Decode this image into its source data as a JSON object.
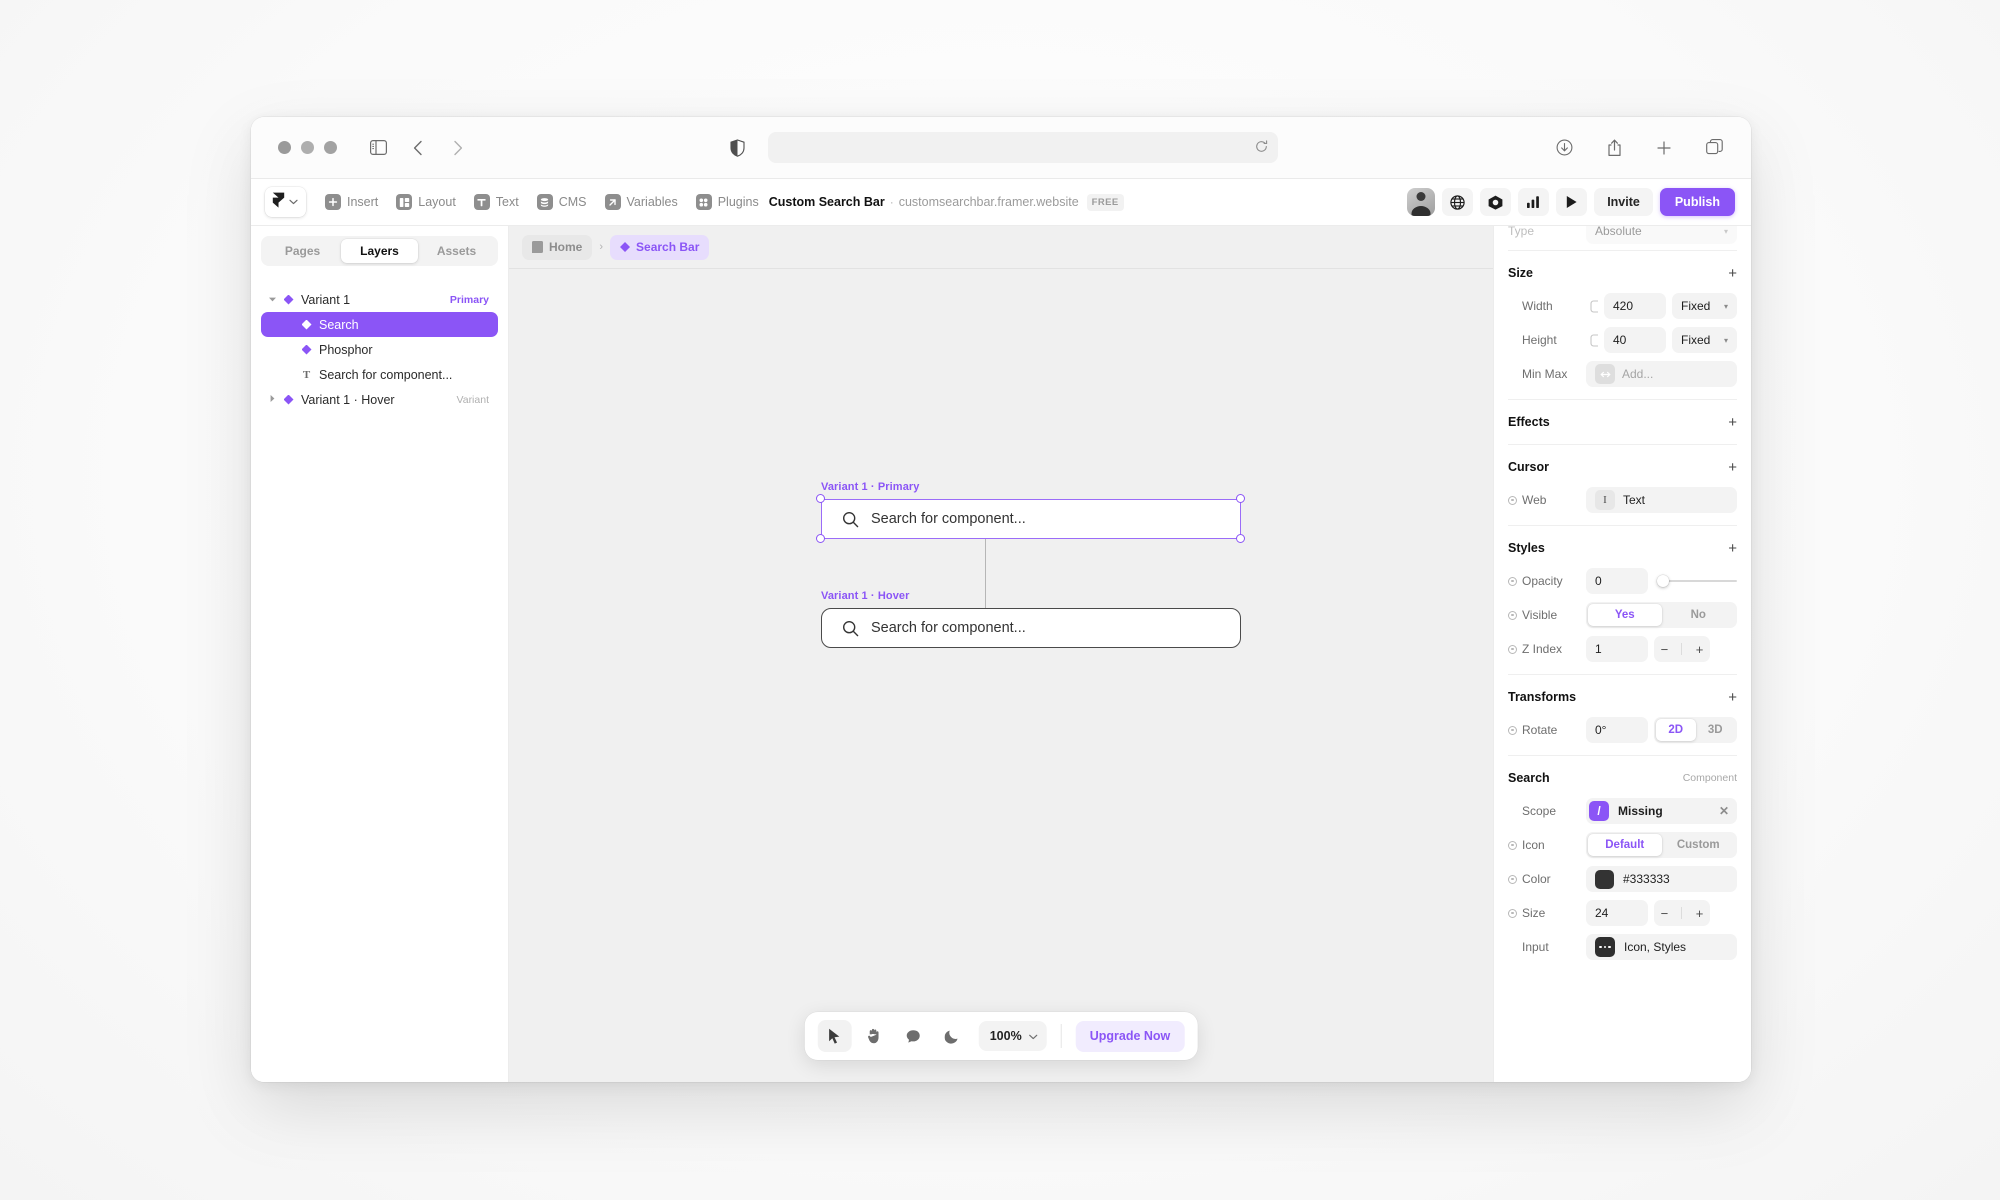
{
  "browser": {
    "url_value": "",
    "url_placeholder": "",
    "icons": {
      "sidebar": "sidebar-icon",
      "back": "chevron-left-icon",
      "forward": "chevron-right-icon",
      "shield": "shield-icon",
      "reload": "reload-icon",
      "download": "download-icon",
      "share": "share-icon",
      "new_tab": "plus-icon",
      "tabs": "copy-tabs-icon"
    }
  },
  "toolbar": {
    "logo": "framer-logo",
    "items": [
      {
        "label": "Insert",
        "icon": "plus-square-icon"
      },
      {
        "label": "Layout",
        "icon": "layout-icon"
      },
      {
        "label": "Text",
        "icon": "text-icon"
      },
      {
        "label": "CMS",
        "icon": "database-icon"
      },
      {
        "label": "Variables",
        "icon": "arrow-up-right-icon"
      },
      {
        "label": "Plugins",
        "icon": "plugins-grid-icon"
      }
    ],
    "plugin_name": "Custom Search Bar",
    "plugin_sep": "·",
    "plugin_url": "customsearchbar.framer.website",
    "plugin_badge": "FREE",
    "right": {
      "avatar": "user-avatar",
      "globe": "globe-icon",
      "record": "record-icon",
      "analytics": "analytics-icon",
      "preview": "play-icon",
      "invite_label": "Invite",
      "publish_label": "Publish",
      "publish_color": "#8b55f6"
    }
  },
  "left_panel": {
    "tabs": [
      {
        "label": "Pages",
        "active": false
      },
      {
        "label": "Layers",
        "active": true
      },
      {
        "label": "Assets",
        "active": false
      }
    ],
    "layers": [
      {
        "name": "Variant 1",
        "tag": "Primary",
        "tag_color": "#8b55f6",
        "icon": "component-diamond-icon",
        "depth": 0,
        "expanded": true,
        "selected": false
      },
      {
        "name": "Search",
        "tag": "",
        "icon": "component-diamond-icon",
        "depth": 1,
        "selected": true
      },
      {
        "name": "Phosphor",
        "tag": "",
        "icon": "component-diamond-icon",
        "depth": 1,
        "selected": false
      },
      {
        "name": "Search for component...",
        "tag": "",
        "icon": "text-layer-icon",
        "depth": 1,
        "selected": false
      },
      {
        "name": "Variant 1 · Hover",
        "tag": "Variant",
        "tag_color": "#b0b0b0",
        "icon": "component-diamond-icon",
        "depth": 0,
        "expanded": false,
        "selected": false
      }
    ]
  },
  "breadcrumb": {
    "home": "Home",
    "separator": "›",
    "current": "Search Bar"
  },
  "canvas": {
    "variants": [
      {
        "label": "Variant 1 · Primary",
        "placeholder": "Search for component...",
        "selected": true
      },
      {
        "label": "Variant 1 · Hover",
        "placeholder": "Search for component...",
        "selected": false
      }
    ],
    "accent": "#8b55f6"
  },
  "bottom_bar": {
    "tools": [
      {
        "name": "pointer-tool",
        "active": true
      },
      {
        "name": "hand-tool",
        "active": false
      },
      {
        "name": "comment-tool",
        "active": false
      },
      {
        "name": "dark-mode-tool",
        "active": false
      }
    ],
    "zoom": "100%",
    "upgrade_label": "Upgrade Now"
  },
  "right_panel": {
    "type_row": {
      "label": "Type",
      "value": "Absolute"
    },
    "size": {
      "title": "Size",
      "width_label": "Width",
      "width_value": "420",
      "width_mode": "Fixed",
      "height_label": "Height",
      "height_value": "40",
      "height_mode": "Fixed",
      "minmax_label": "Min Max",
      "minmax_placeholder": "Add..."
    },
    "effects": {
      "title": "Effects"
    },
    "cursor": {
      "title": "Cursor",
      "web_label": "Web",
      "web_value": "Text"
    },
    "styles": {
      "title": "Styles",
      "opacity_label": "Opacity",
      "opacity_value": "0",
      "visible_label": "Visible",
      "visible_yes": "Yes",
      "visible_no": "No",
      "visible_selected": "Yes",
      "zindex_label": "Z Index",
      "zindex_value": "1"
    },
    "transforms": {
      "title": "Transforms",
      "rotate_label": "Rotate",
      "rotate_value": "0°",
      "mode_2d": "2D",
      "mode_3d": "3D",
      "mode_selected": "2D"
    },
    "search": {
      "title": "Search",
      "subtitle": "Component",
      "scope_label": "Scope",
      "scope_value": "Missing",
      "scope_glyph": "/",
      "icon_label": "Icon",
      "icon_default": "Default",
      "icon_custom": "Custom",
      "icon_selected": "Default",
      "color_label": "Color",
      "color_value": "#333333",
      "color_hex": "#333333",
      "size_label": "Size",
      "size_value": "24",
      "input_label": "Input",
      "input_value": "Icon, Styles"
    }
  }
}
